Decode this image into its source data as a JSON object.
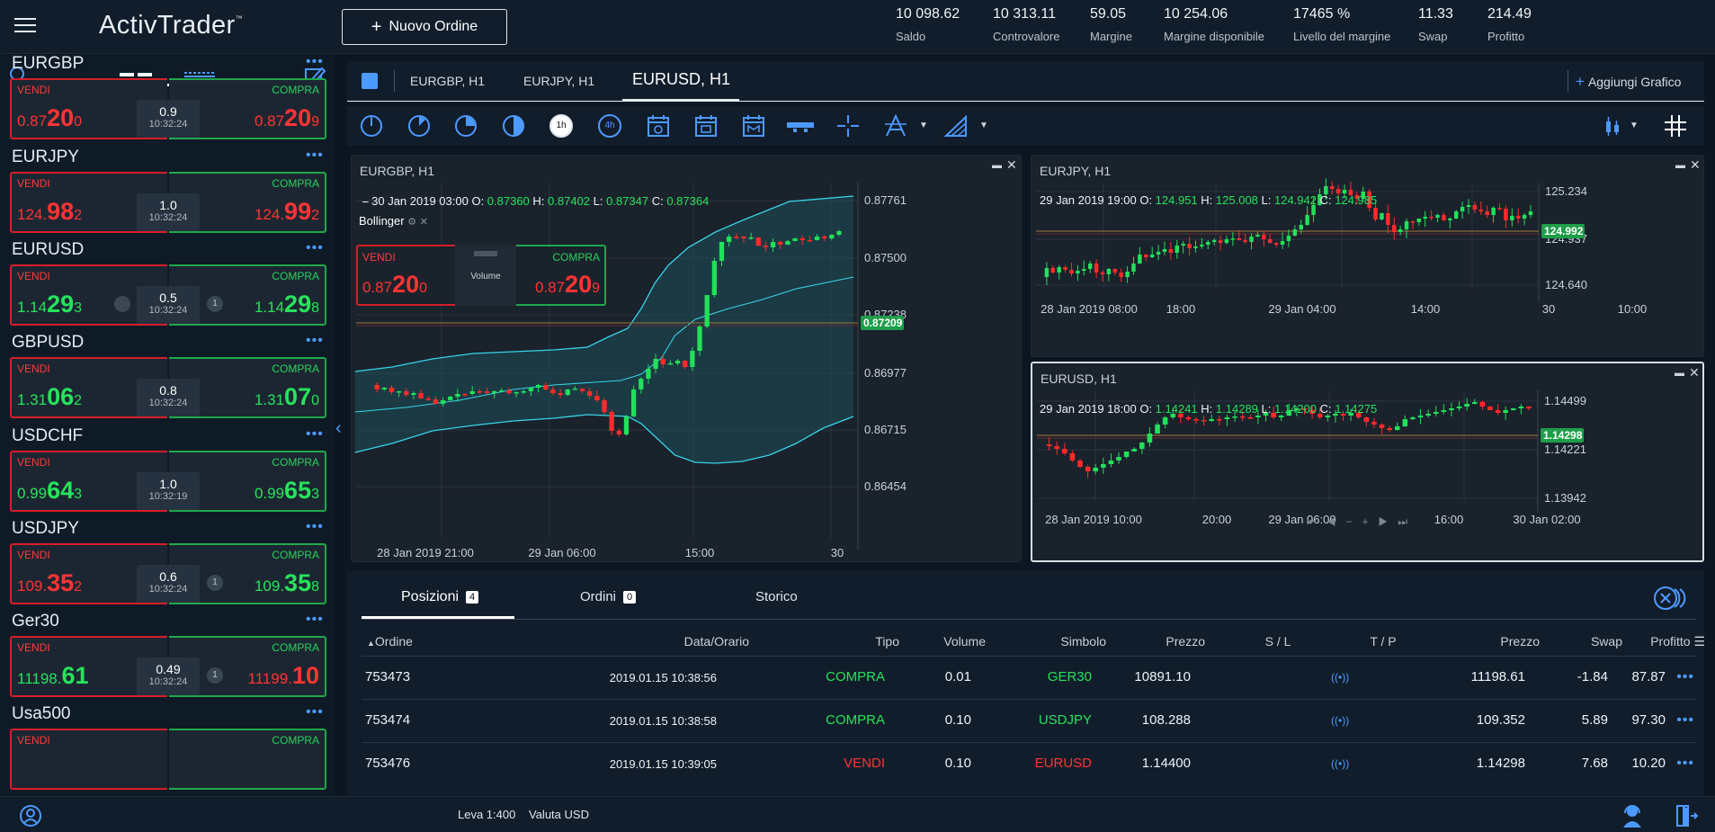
{
  "app": {
    "logo": "ActivTrader",
    "tm": "™"
  },
  "header": {
    "new_order_label": "Nuovo Ordine",
    "stats": [
      {
        "value": "10 098.62",
        "label": "Saldo"
      },
      {
        "value": "10 313.11",
        "label": "Controvalore"
      },
      {
        "value": "59.05",
        "label": "Margine"
      },
      {
        "value": "10 254.06",
        "label": "Margine disponibile"
      },
      {
        "value": "17465 %",
        "label": "Livello del margine"
      },
      {
        "value": "11.33",
        "label": "Swap"
      },
      {
        "value": "214.49",
        "label": "Profitto"
      }
    ]
  },
  "instruments": [
    {
      "name": "EURGBP",
      "sell_label": "VENDI",
      "buy_label": "COMPRA",
      "sell": [
        "0.87",
        "20",
        "0"
      ],
      "buy": [
        "0.87",
        "20",
        "9"
      ],
      "spread": "0.9",
      "time": "10:32:24",
      "sell_color": "red",
      "buy_color": "red",
      "badge_left": "",
      "badge_right": ""
    },
    {
      "name": "EURJPY",
      "sell_label": "VENDI",
      "buy_label": "COMPRA",
      "sell": [
        "124.",
        "98",
        "2"
      ],
      "buy": [
        "124.",
        "99",
        "2"
      ],
      "spread": "1.0",
      "time": "10:32:24",
      "sell_color": "red",
      "buy_color": "red",
      "badge_left": "",
      "badge_right": ""
    },
    {
      "name": "EURUSD",
      "sell_label": "VENDI",
      "buy_label": "COMPRA",
      "sell": [
        "1.14",
        "29",
        "3"
      ],
      "buy": [
        "1.14",
        "29",
        "8"
      ],
      "spread": "0.5",
      "time": "10:32:24",
      "sell_color": "grn",
      "buy_color": "grn",
      "badge_left": "",
      "badge_right": "1"
    },
    {
      "name": "GBPUSD",
      "sell_label": "VENDI",
      "buy_label": "COMPRA",
      "sell": [
        "1.31",
        "06",
        "2"
      ],
      "buy": [
        "1.31",
        "07",
        "0"
      ],
      "spread": "0.8",
      "time": "10:32:24",
      "sell_color": "grn",
      "buy_color": "grn",
      "badge_left": "",
      "badge_right": ""
    },
    {
      "name": "USDCHF",
      "sell_label": "VENDI",
      "buy_label": "COMPRA",
      "sell": [
        "0.99",
        "64",
        "3"
      ],
      "buy": [
        "0.99",
        "65",
        "3"
      ],
      "spread": "1.0",
      "time": "10:32:19",
      "sell_color": "grn",
      "buy_color": "grn",
      "badge_left": "",
      "badge_right": ""
    },
    {
      "name": "USDJPY",
      "sell_label": "VENDI",
      "buy_label": "COMPRA",
      "sell": [
        "109.",
        "35",
        "2"
      ],
      "buy": [
        "109.",
        "35",
        "8"
      ],
      "spread": "0.6",
      "time": "10:32:24",
      "sell_color": "red",
      "buy_color": "grn",
      "badge_left": "",
      "badge_right": "1"
    },
    {
      "name": "Ger30",
      "sell_label": "VENDI",
      "buy_label": "COMPRA",
      "sell": [
        "11198.",
        "61",
        ""
      ],
      "buy": [
        "11199.",
        "10",
        ""
      ],
      "spread": "0.49",
      "time": "10:32:24",
      "sell_color": "grn",
      "buy_color": "red",
      "badge_left": "",
      "badge_right": "1"
    },
    {
      "name": "Usa500",
      "sell_label": "VENDI",
      "buy_label": "COMPRA",
      "sell": [
        "",
        "",
        ""
      ],
      "buy": [
        "",
        "",
        ""
      ],
      "spread": "",
      "time": "",
      "sell_color": "red",
      "buy_color": "grn",
      "badge_left": "",
      "badge_right": ""
    }
  ],
  "tabs": {
    "items": [
      "EURGBP, H1",
      "EURJPY, H1",
      "EURUSD, H1"
    ],
    "add_chart": "Aggiungi Grafico"
  },
  "toolbar": {
    "timeframes": [
      "1h",
      "4h"
    ]
  },
  "charts": {
    "eurgbp": {
      "title": "EURGBP, H1",
      "date": "30 Jan 2019 03:00",
      "o": "0.87360",
      "h": "0.87402",
      "l": "0.87347",
      "c": "0.87364",
      "indicator": "Bollinger",
      "sell_label": "VENDI",
      "buy_label": "COMPRA",
      "sell": [
        "0.87",
        "20",
        "0"
      ],
      "buy": [
        "0.87",
        "20",
        "9"
      ],
      "volume_label": "Volume",
      "price_tag": "0.87209",
      "yaxis": [
        "0.87761",
        "0.87500",
        "0.87238",
        "0.86977",
        "0.86715",
        "0.86454"
      ],
      "xaxis": [
        "28 Jan 2019 21:00",
        "29 Jan 06:00",
        "15:00",
        "30"
      ]
    },
    "eurjpy": {
      "title": "EURJPY, H1",
      "date": "29 Jan 2019 19:00",
      "o": "124.951",
      "h": "125.008",
      "l": "124.942",
      "c": "124.985",
      "price_tag": "124.992",
      "yaxis": [
        "125.234",
        "124.937",
        "124.640"
      ],
      "xaxis": [
        "28 Jan 2019 08:00",
        "18:00",
        "29 Jan 04:00",
        "14:00",
        "30",
        "10:00"
      ]
    },
    "eurusd": {
      "title": "EURUSD, H1",
      "date": "29 Jan 2019 18:00",
      "o": "1.14241",
      "h": "1.14289",
      "l": "1.14200",
      "c": "1.14275",
      "price_tag": "1.14298",
      "yaxis": [
        "1.14499",
        "1.14221",
        "1.13942"
      ],
      "xaxis": [
        "28 Jan 2019 10:00",
        "20:00",
        "29 Jan 06:00",
        "16:00",
        "30 Jan 02:00"
      ]
    }
  },
  "bottom": {
    "tabs": [
      {
        "label": "Posizioni",
        "count": "4"
      },
      {
        "label": "Ordini",
        "count": "0"
      },
      {
        "label": "Storico",
        "count": ""
      }
    ],
    "headers": [
      "Ordine",
      "Data/Orario",
      "Tipo",
      "Volume",
      "Simbolo",
      "Prezzo",
      "S / L",
      "T / P",
      "Prezzo",
      "Swap",
      "Profitto"
    ],
    "rows": [
      {
        "order": "753473",
        "date": "2019.01.15 10:38:56",
        "type": "COMPRA",
        "type_color": "grn",
        "volume": "0.01",
        "symbol": "GER30",
        "price": "10891.10",
        "cur_price": "11198.61",
        "swap": "-1.84",
        "profit": "87.87"
      },
      {
        "order": "753474",
        "date": "2019.01.15 10:38:58",
        "type": "COMPRA",
        "type_color": "grn",
        "volume": "0.10",
        "symbol": "USDJPY",
        "price": "108.288",
        "cur_price": "109.352",
        "swap": "5.89",
        "profit": "97.30"
      },
      {
        "order": "753476",
        "date": "2019.01.15 10:39:05",
        "type": "VENDI",
        "type_color": "red",
        "volume": "0.10",
        "symbol": "EURUSD",
        "price": "1.14400",
        "cur_price": "1.14298",
        "swap": "7.68",
        "profit": "10.20"
      }
    ]
  },
  "statusbar": {
    "leverage": "Leva 1:400",
    "currency": "Valuta USD"
  }
}
